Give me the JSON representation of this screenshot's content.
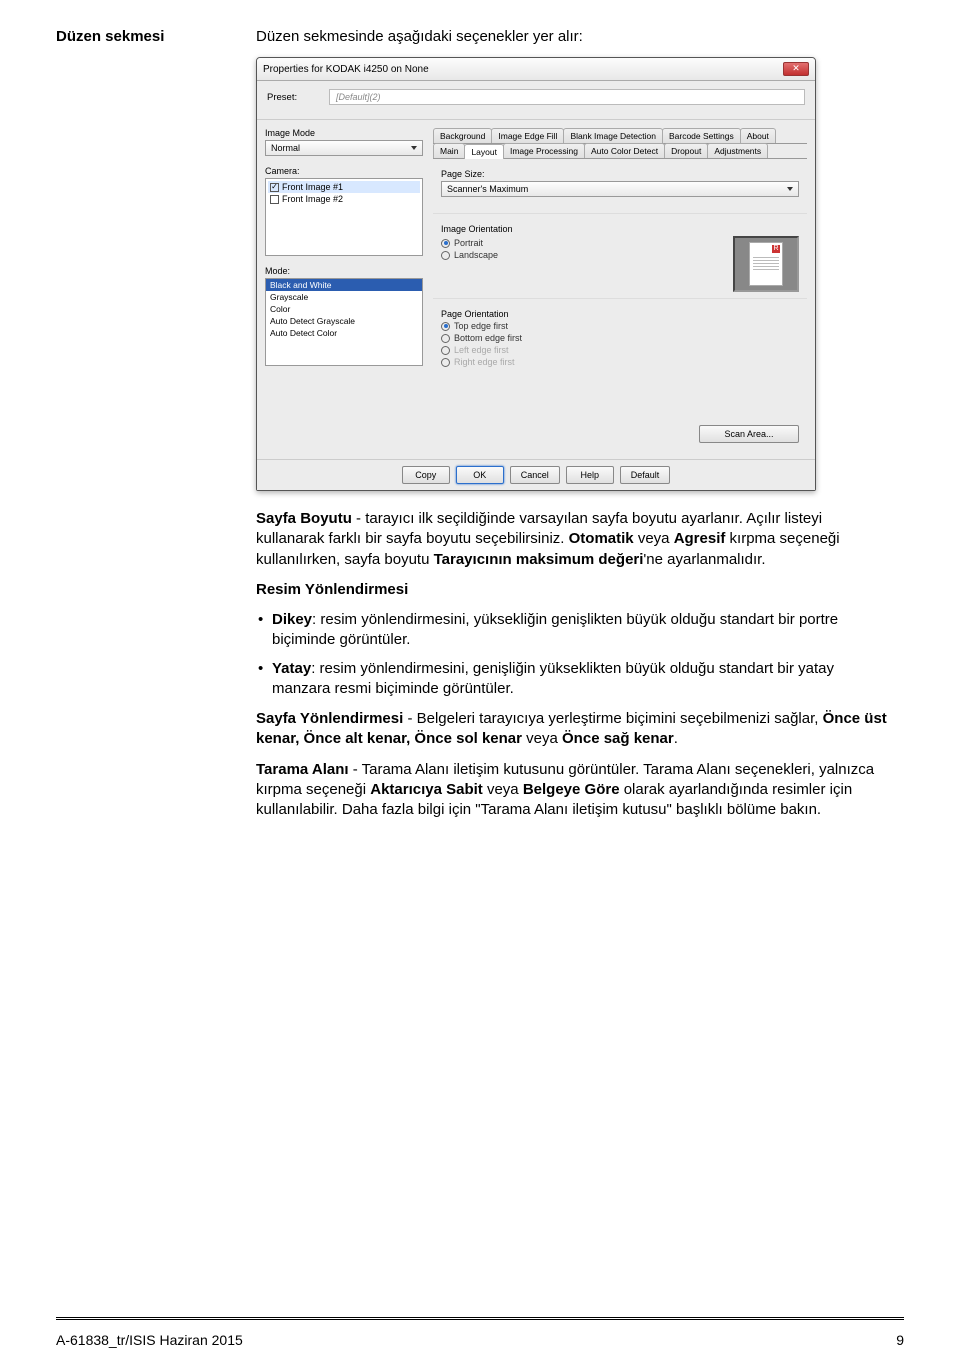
{
  "header": {
    "label": "Düzen sekmesi",
    "text": "Düzen sekmesinde aşağıdaki seçenekler yer alır:"
  },
  "dialog": {
    "title": "Properties for KODAK i4250 on None",
    "close": "✕",
    "preset_label": "Preset:",
    "preset_value": "[Default](2)",
    "image_mode_label": "Image Mode",
    "image_mode_value": "Normal",
    "camera_label": "Camera:",
    "camera_items": [
      {
        "checked": true,
        "label": "Front Image #1"
      },
      {
        "checked": false,
        "label": "Front Image #2"
      }
    ],
    "mode_label": "Mode:",
    "mode_items": [
      "Black and White",
      "Grayscale",
      "Color",
      "Auto Detect Grayscale",
      "Auto Detect Color"
    ],
    "tabs_top": [
      "Background",
      "Image Edge Fill",
      "Blank Image Detection",
      "Barcode Settings",
      "About"
    ],
    "tabs_bot": [
      "Main",
      "Layout",
      "Image Processing",
      "Auto Color Detect",
      "Dropout",
      "Adjustments"
    ],
    "page_size_label": "Page Size:",
    "page_size_value": "Scanner's Maximum",
    "img_orient_label": "Image Orientation",
    "img_orient_opts": [
      {
        "label": "Portrait",
        "on": true
      },
      {
        "label": "Landscape",
        "on": false
      }
    ],
    "page_orient_label": "Page Orientation",
    "page_orient_opts": [
      {
        "label": "Top edge first",
        "on": true,
        "disabled": false
      },
      {
        "label": "Bottom edge first",
        "on": false,
        "disabled": false
      },
      {
        "label": "Left edge first",
        "on": false,
        "disabled": true
      },
      {
        "label": "Right edge first",
        "on": false,
        "disabled": true
      }
    ],
    "scan_area_btn": "Scan Area...",
    "footer_btns": [
      "Copy",
      "OK",
      "Cancel",
      "Help",
      "Default"
    ]
  },
  "body": {
    "p1a": "Sayfa Boyutu",
    "p1b": " - tarayıcı ilk seçildiğinde varsayılan sayfa boyutu ayarlanır. Açılır listeyi kullanarak farklı bir sayfa boyutu seçebilirsiniz. ",
    "p1c": "Otomatik",
    "p1d": " veya ",
    "p1e": "Agresif",
    "p1f": " kırpma seçeneği kullanılırken, sayfa boyutu ",
    "p1g": "Tarayıcının maksimum değeri",
    "p1h": "'ne ayarlanmalıdır.",
    "h2": "Resim Yönlendirmesi",
    "li1a": "Dikey",
    "li1b": ": resim yönlendirmesini, yüksekliğin genişlikten büyük olduğu standart bir portre biçiminde görüntüler.",
    "li2a": "Yatay",
    "li2b": ": resim yönlendirmesini, genişliğin yükseklikten büyük olduğu standart bir yatay manzara resmi biçiminde görüntüler.",
    "p3a": "Sayfa Yönlendirmesi",
    "p3b": " - Belgeleri tarayıcıya yerleştirme biçimini seçebilmenizi sağlar, ",
    "p3c": "Önce üst kenar, Önce alt kenar, Önce sol kenar",
    "p3d": " veya ",
    "p3e": "Önce sağ kenar",
    "p3f": ".",
    "p4a": "Tarama Alanı",
    "p4b": " - Tarama Alanı iletişim kutusunu görüntüler. Tarama Alanı seçenekleri, yalnızca kırpma seçeneği ",
    "p4c": "Aktarıcıya Sabit",
    "p4d": " veya ",
    "p4e": "Belgeye Göre",
    "p4f": " olarak ayarlandığında resimler için kullanılabilir. Daha fazla bilgi için \"Tarama Alanı iletişim kutusu\" başlıklı bölüme bakın."
  },
  "footer": {
    "left": "A-61838_tr/ISIS  Haziran 2015",
    "right": "9"
  }
}
